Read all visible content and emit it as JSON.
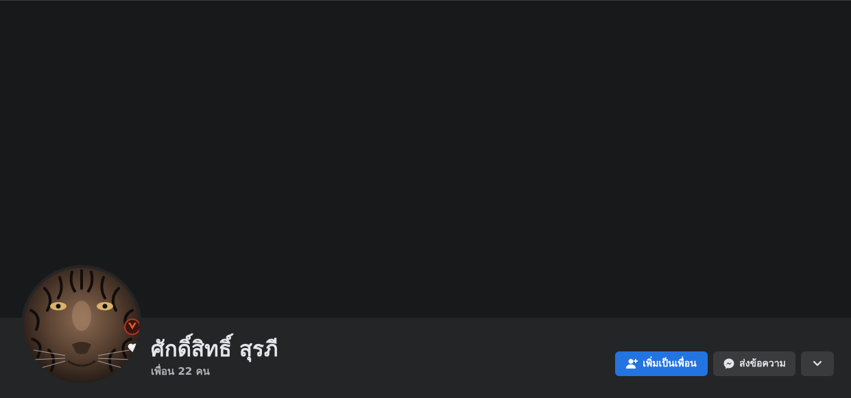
{
  "profile": {
    "name": "ศักดิ์สิทธิ์ สุรภี",
    "friends_text": "เพื่อน 22 คน"
  },
  "actions": {
    "add_friend_label": "เพิ่มเป็นเพื่อน",
    "message_label": "ส่งข้อความ"
  },
  "icons": {
    "add_friend": "person-plus-icon",
    "message": "messenger-icon",
    "more": "chevron-down-icon"
  },
  "colors": {
    "background": "#18191a",
    "header_bar": "#242526",
    "primary_button": "#2374e1",
    "secondary_button": "#3a3b3c"
  }
}
